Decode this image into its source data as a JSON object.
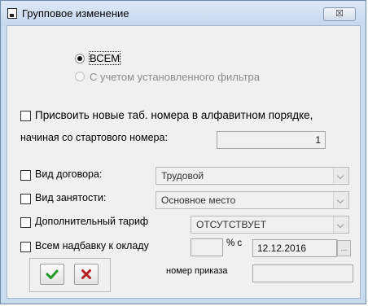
{
  "window": {
    "title": "Групповое изменение",
    "close_glyph": "☒"
  },
  "scope": {
    "option_all": "ВСЕМ",
    "option_filter": "С учетом установленного фильтра",
    "selected": "all"
  },
  "renumber": {
    "label": "Присвоить новые таб. номера в алфавитном порядке,",
    "start_label": "начиная со стартового номера:",
    "start_value": "1",
    "checked": false
  },
  "contract": {
    "label": "Вид договора:",
    "value": "Трудовой",
    "checked": false
  },
  "employment": {
    "label": "Вид занятости:",
    "value": "Основное место",
    "checked": false
  },
  "tariff": {
    "label": "Дополнительный тариф",
    "value": "ОТСУТСТВУЕТ",
    "checked": false
  },
  "bonus": {
    "label": "Всем надбавку к окладу",
    "percent_value": "",
    "percent_label": "% с",
    "date_value": "12.12.2016",
    "ellipsis": "...",
    "order_label": "номер приказа",
    "order_value": "",
    "checked": false
  },
  "actions": {
    "ok_icon": "check-icon",
    "cancel_icon": "cross-icon",
    "ok_color": "#1f9a24",
    "cancel_color": "#b51e1e"
  }
}
